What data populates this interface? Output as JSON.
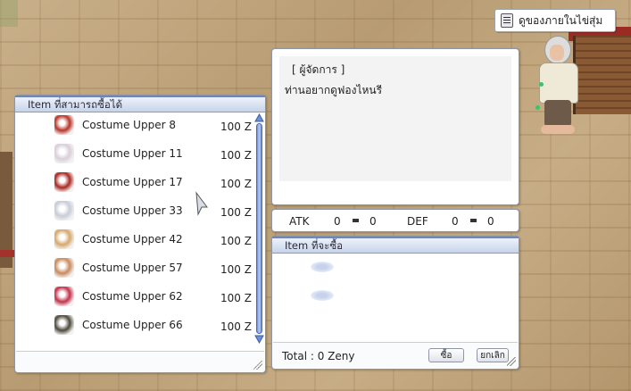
{
  "tooltip": {
    "label": "ดูของภายในไข่สุ่ม",
    "icon": "chat-icon"
  },
  "shop": {
    "title": "Item ที่สามารถซื้อได้",
    "items": [
      {
        "name": "Costume Upper 8",
        "price": "100 Z",
        "icon": "costume-devil-wings-icon",
        "color": "#b8352a"
      },
      {
        "name": "Costume Upper 11",
        "price": "100 Z",
        "icon": "costume-bird-hat-icon",
        "color": "#d9cfd8"
      },
      {
        "name": "Costume Upper 17",
        "price": "100 Z",
        "icon": "costume-red-hat-icon",
        "color": "#a92821"
      },
      {
        "name": "Costume Upper 33",
        "price": "100 Z",
        "icon": "costume-white-wings-icon",
        "color": "#c7ccd6"
      },
      {
        "name": "Costume Upper 42",
        "price": "100 Z",
        "icon": "costume-straw-hat-icon",
        "color": "#d7a86a"
      },
      {
        "name": "Costume Upper 57",
        "price": "100 Z",
        "icon": "costume-horned-crown-icon",
        "color": "#c98a5c"
      },
      {
        "name": "Costume Upper 62",
        "price": "100 Z",
        "icon": "costume-monster-mask-icon",
        "color": "#c4314a"
      },
      {
        "name": "Costume Upper 66",
        "price": "100 Z",
        "icon": "costume-sunglasses-icon",
        "color": "#4d4a3c"
      }
    ]
  },
  "dialog": {
    "speaker": "[ ผู้จัดการ ]",
    "message": "ท่านอยากดูฟองไหนรี"
  },
  "stats": {
    "atk_label": "ATK",
    "atk_a": "0",
    "atk_b": "0",
    "def_label": "DEF",
    "def_a": "0",
    "def_b": "0"
  },
  "buy": {
    "title": "Item ที่จะซื้อ",
    "total": "Total : 0 Zeny",
    "buy_label": "ซื้อ",
    "cancel_label": "ยกเลิก"
  }
}
